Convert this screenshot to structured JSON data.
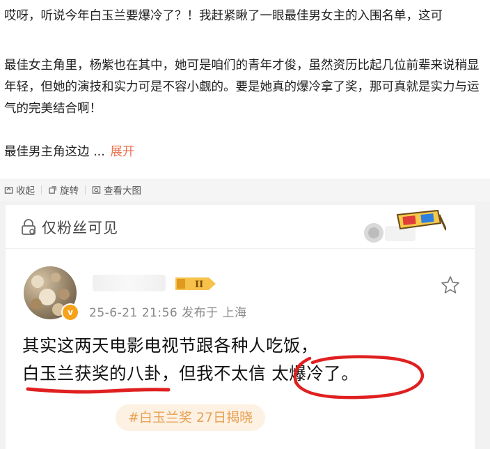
{
  "post": {
    "line1": "哎呀，听说今年白玉兰要爆冷了？！我赶紧瞅了一眼最佳男女主的入围名单，这可",
    "line2": "最佳女主角里，杨紫也在其中，她可是咱们的青年才俊，虽然资历比起几位前辈来说稍显年轻，但她的演技和实力可是不容小觑的。要是她真的爆冷拿了奖，那可真就是实力与运气的完美结合啊！",
    "line3": "最佳男主角这边",
    "ellipsis": "...",
    "expand": "展开"
  },
  "toolbar": {
    "collapse": "收起",
    "rotate": "旋转",
    "view_large": "查看大图"
  },
  "card": {
    "fans_only": "仅粉丝可见",
    "level": "II",
    "avatar_badge": "v",
    "meta": "25-6-21 21:56  发布于 上海",
    "quote_line1": "其实这两天电影电视节跟各种人吃饭，",
    "quote_line2": "白玉兰获奖的八卦，但我不太信 太爆冷了。",
    "hashtag": "#白玉兰奖 27日揭晓"
  },
  "colors": {
    "link": "#eb7350",
    "red_mark": "#e02020",
    "hashtag_text": "#e8a050"
  }
}
